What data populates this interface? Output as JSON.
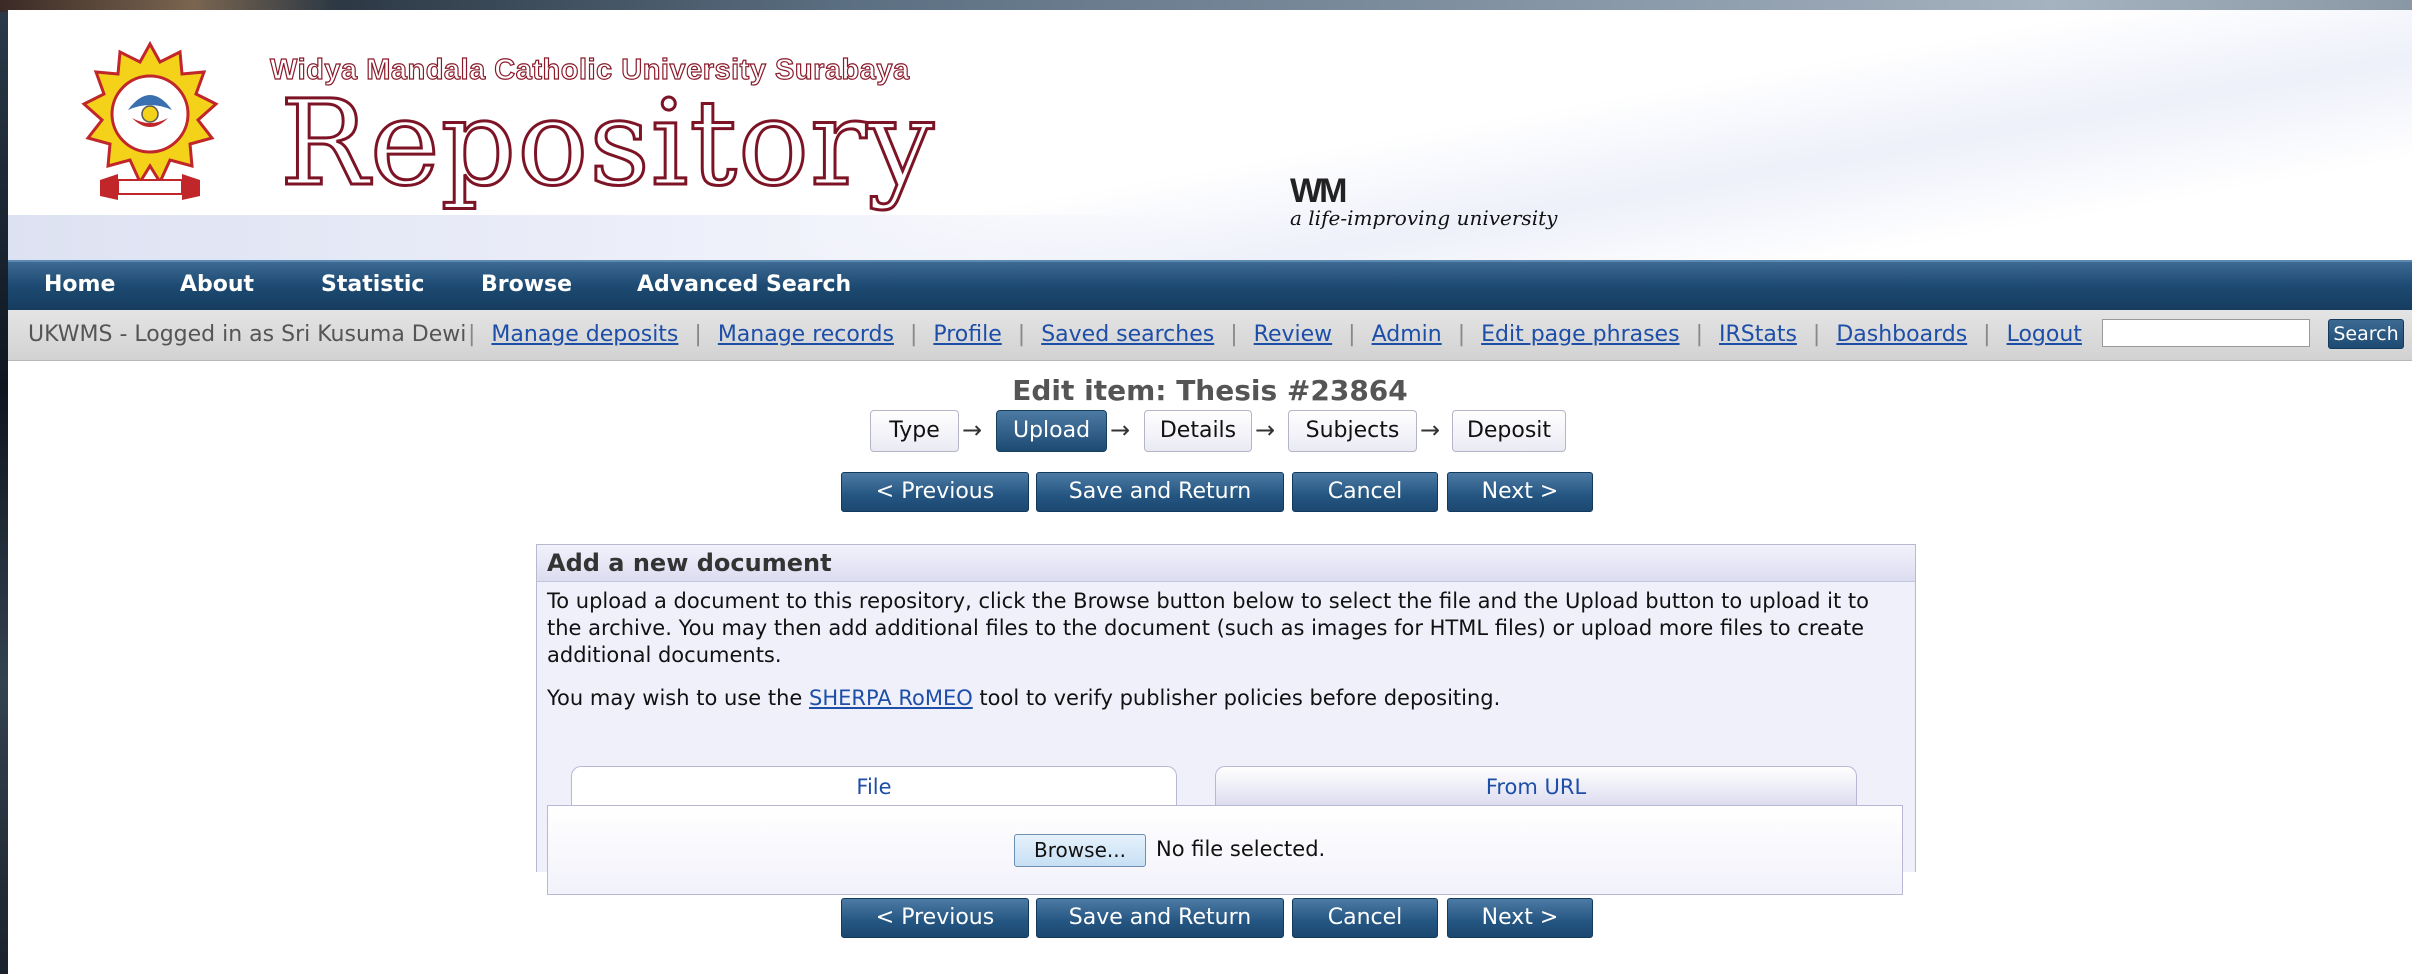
{
  "header": {
    "university": "Widya Mandala Catholic University Surabaya",
    "title": "Repository",
    "wm_tagline": "a life-improving university",
    "wm_mark": "WM"
  },
  "nav": [
    "Home",
    "About",
    "Statistic",
    "Browse",
    "Advanced Search"
  ],
  "user_bar": {
    "logged_in": "UKWMS - Logged in as Sri Kusuma Dewi",
    "links": [
      "Manage deposits",
      "Manage records",
      "Profile",
      "Saved searches",
      "Review",
      "Admin",
      "Edit page phrases",
      "IRStats",
      "Dashboards",
      "Logout"
    ],
    "search_button": "Search"
  },
  "edit": {
    "title": "Edit item: Thesis #23864",
    "stages": [
      "Type",
      "Upload",
      "Details",
      "Subjects",
      "Deposit"
    ],
    "active_stage": "Upload"
  },
  "buttons": {
    "previous": "< Previous",
    "save_return": "Save and Return",
    "cancel": "Cancel",
    "next": "Next >"
  },
  "upload": {
    "heading": "Add a new document",
    "instructions": "To upload a document to this repository, click the Browse button below to select the file and the Upload button to upload it to the archive. You may then add additional files to the document (such as images for HTML files) or upload more files to create additional documents.",
    "sherpa_before": "You may wish to use the ",
    "sherpa_link": "SHERPA RoMEO",
    "sherpa_after": " tool to verify publisher policies before depositing.",
    "tabs": [
      "File",
      "From URL"
    ],
    "browse_label": "Browse...",
    "no_file": "No file selected."
  },
  "colors": {
    "nav_bg": "#1d4a72",
    "link": "#1d4ea8",
    "brand_red": "#7d1426"
  }
}
